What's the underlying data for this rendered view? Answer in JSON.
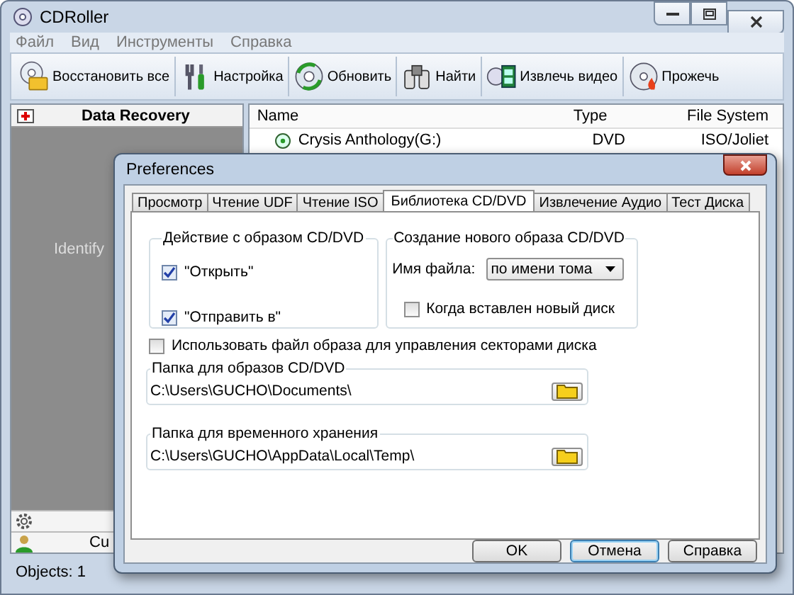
{
  "window": {
    "title": "CDRoller"
  },
  "menu": [
    "Файл",
    "Вид",
    "Инструменты",
    "Справка"
  ],
  "toolbar": [
    "Восстановить все",
    "Настройка",
    "Обновить",
    "Найти",
    "Извлечь видео",
    "Прожечь"
  ],
  "left_panel": {
    "title": "Data Recovery",
    "text": "Identify",
    "bottom_label": "Cu"
  },
  "file_list": {
    "columns": [
      "Name",
      "Type",
      "File System"
    ],
    "rows": [
      {
        "name": "Crysis Anthology(G:)",
        "type": "DVD",
        "file_system": "ISO/Joliet"
      }
    ]
  },
  "status_bar": "Objects: 1",
  "dialog": {
    "title": "Preferences",
    "tabs": [
      {
        "label": "Просмотр",
        "selected": false
      },
      {
        "label": "Чтение UDF",
        "selected": false
      },
      {
        "label": "Чтение ISO",
        "selected": false
      },
      {
        "label": "Библиотека CD/DVD",
        "selected": true
      },
      {
        "label": "Извлечение Аудио",
        "selected": false
      },
      {
        "label": "Тест Диска",
        "selected": false
      }
    ],
    "image_action": {
      "title": "Действие с образом CD/DVD",
      "options": [
        {
          "label": "\"Открыть\"",
          "checked": true
        },
        {
          "label": "\"Отправить в\"",
          "checked": true
        }
      ]
    },
    "new_image": {
      "title": "Создание нового образа CD/DVD",
      "filename_label": "Имя файла:",
      "filename_value": "по имени тома",
      "option": {
        "label": "Когда вставлен новый диск",
        "checked": false
      }
    },
    "use_image_file": {
      "label": "Использовать файл образа для управления секторами диска",
      "checked": false
    },
    "folders": [
      {
        "title": "Папка для образов CD/DVD",
        "value": "C:\\Users\\GUCHO\\Documents\\"
      },
      {
        "title": "Папка для временного хранения",
        "value": "C:\\Users\\GUCHO\\AppData\\Local\\Temp\\"
      }
    ],
    "buttons": [
      {
        "label": "OK",
        "focused": false
      },
      {
        "label": "Отмена",
        "focused": true
      },
      {
        "label": "Справка",
        "focused": false
      }
    ]
  }
}
